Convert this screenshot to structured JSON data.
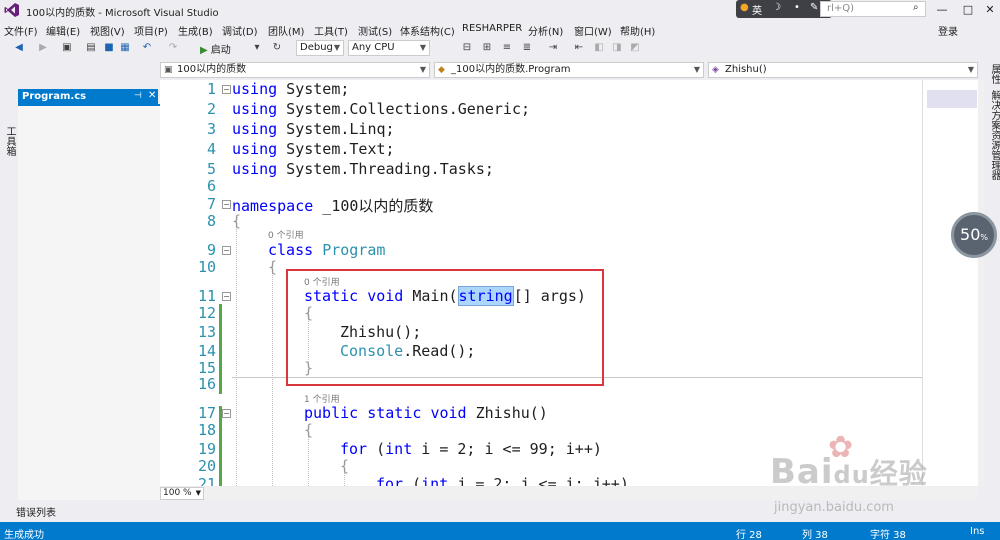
{
  "window": {
    "title": "100以内的质数 - Microsoft Visual Studio",
    "quick_launch_placeholder": "rl+Q)",
    "ime_label": "英",
    "login": "登录",
    "minimize": "—",
    "close": "✕"
  },
  "menu": [
    "文件(F)",
    "编辑(E)",
    "视图(V)",
    "项目(P)",
    "生成(B)",
    "调试(D)",
    "团队(M)",
    "工具(T)",
    "测试(S)",
    "体系结构(C)",
    "RESHARPER",
    "分析(N)",
    "窗口(W)",
    "帮助(H)"
  ],
  "toolbar": {
    "start_label": "启动",
    "config": "Debug",
    "platform": "Any CPU"
  },
  "left_strip": {
    "label": "工具箱"
  },
  "doc_tab": {
    "label": "Program.cs"
  },
  "navbar": {
    "project": "100以内的质数",
    "class": "_100以内的质数.Program",
    "member": "Zhishu()"
  },
  "editor": {
    "line_numbers": [
      "1",
      "2",
      "3",
      "4",
      "5",
      "6",
      "7",
      "8",
      "9",
      "10",
      "11",
      "12",
      "13",
      "14",
      "15",
      "16",
      "17",
      "18",
      "19",
      "20",
      "21"
    ],
    "ref_labels": [
      "0 个引用",
      "0 个引用",
      "1 个引用"
    ],
    "code": {
      "l1_kw": "using",
      "l1_rest": " System;",
      "l2_kw": "using",
      "l2_rest": " System.Collections.Generic;",
      "l3_kw": "using",
      "l3_rest": " System.Linq;",
      "l4_kw": "using",
      "l4_rest": " System.Text;",
      "l5_kw": "using",
      "l5_rest": " System.Threading.Tasks;",
      "l7_kw": "namespace",
      "l7_rest": " _100以内的质数",
      "l8": "{",
      "l9_kw": "class",
      "l9_ty": "Program",
      "l10": "{",
      "l11_kw1": "static",
      "l11_kw2": "void",
      "l11_name": " Main(",
      "l11_sel": "string",
      "l11_rest": "[] args)",
      "l12": "{",
      "l13": "Zhishu();",
      "l14_ty": "Console",
      "l14_rest": ".Read();",
      "l15": "}",
      "l17_kw1": "public",
      "l17_kw2": "static",
      "l17_kw3": "void",
      "l17_rest": " Zhishu()",
      "l18": "{",
      "l19_kw": "for",
      "l19_rest1": " (",
      "l19_kw2": "int",
      "l19_rest2": " i = 2; i <= 99; i++)",
      "l20": "{",
      "l21_kw": "for",
      "l21_rest1": " (",
      "l21_kw2": "int",
      "l21_rest2": " j = 2; j <= i; j++)"
    }
  },
  "right_strip": {
    "label1": "属性",
    "label2": "解决方案资源管理器"
  },
  "zoom_overlay": {
    "value": "50",
    "unit": "%"
  },
  "zoom_combo": "100 %",
  "error_list_tab": "错误列表",
  "status": {
    "message": "生成成功",
    "line": "行 28",
    "col": "列 38",
    "char": "字符 38",
    "mode": "Ins"
  },
  "watermark": {
    "brand": "Bai",
    "brand2": "经验",
    "url": "jingyan.baidu.com"
  },
  "colors": {
    "accent": "#007acc",
    "keyword": "#0000ff",
    "type": "#2b91af",
    "highlight_box": "#d9363e"
  }
}
